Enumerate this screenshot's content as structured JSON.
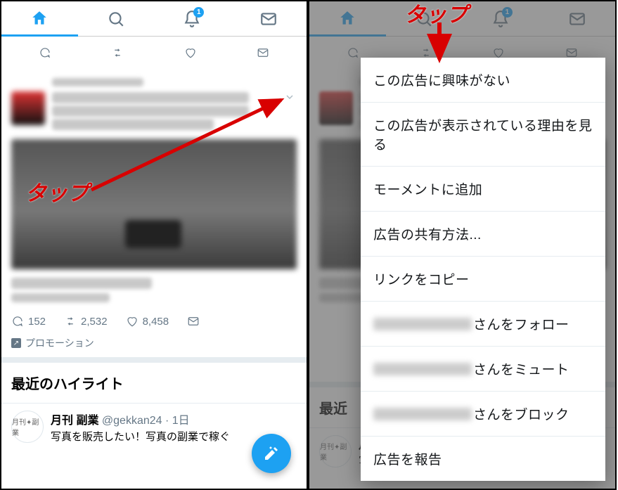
{
  "nav": {
    "notif_badge": "1"
  },
  "tweet": {
    "reply_count": "152",
    "retweet_count": "2,532",
    "like_count": "8,458",
    "promoted_label": "プロモーション"
  },
  "highlights": {
    "title": "最近のハイライト",
    "title_short": "最近"
  },
  "item": {
    "name": "月刊 副業",
    "handle": "@gekkan24",
    "time": "1日",
    "avatar_label": "月刊✦副業",
    "text": "写真を販売したい！写真の副業で稼ぐ"
  },
  "menu": {
    "not_interested": "この広告に興味がない",
    "why_ad": "この広告が表示されている理由を見る",
    "add_moment": "モーメントに追加",
    "share_method": "広告の共有方法...",
    "copy_link": "リンクをコピー",
    "follow_suffix": "さんをフォロー",
    "mute_suffix": "さんをミュート",
    "block_suffix": "さんをブロック",
    "report_ad": "広告を報告"
  },
  "annotations": {
    "tap_left": "タップ",
    "tap_right": "タップ"
  }
}
